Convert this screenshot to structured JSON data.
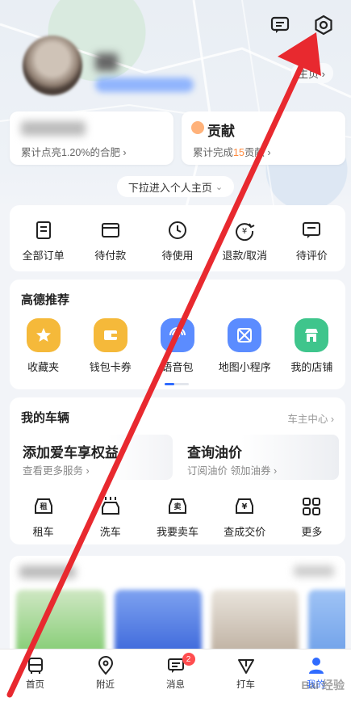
{
  "header": {
    "home_link": "主页 ›",
    "icons": [
      "message-icon",
      "settings-icon"
    ]
  },
  "stats": [
    {
      "title": "",
      "sub_pre": "累计点亮1.20%的合肥",
      "sub_hl": "",
      "sub_post": " ›"
    },
    {
      "title": "贡献",
      "sub_pre": "累计完成",
      "sub_hl": "15",
      "sub_post": "贡献 ›"
    }
  ],
  "pull_tip": "下拉进入个人主页",
  "orders": [
    {
      "label": "全部订单",
      "icon": "list-icon"
    },
    {
      "label": "待付款",
      "icon": "wallet-icon"
    },
    {
      "label": "待使用",
      "icon": "clock-icon"
    },
    {
      "label": "退款/取消",
      "icon": "refund-icon"
    },
    {
      "label": "待评价",
      "icon": "review-icon"
    }
  ],
  "recommend": {
    "title": "高德推荐",
    "items": [
      {
        "label": "收藏夹",
        "icon": "star-icon",
        "color": "#f5b93a"
      },
      {
        "label": "钱包卡券",
        "icon": "wallet-icon",
        "color": "#f5b93a"
      },
      {
        "label": "语音包",
        "icon": "voice-icon",
        "color": "#5b8cff"
      },
      {
        "label": "地图小程序",
        "icon": "mini-app-icon",
        "color": "#5b8cff"
      },
      {
        "label": "我的店铺",
        "icon": "shop-icon",
        "color": "#3fc58c"
      }
    ]
  },
  "vehicle": {
    "title": "我的车辆",
    "link": "车主中心 ›",
    "box1_title": "添加爱车享权益",
    "box1_sub": "查看更多服务 ›",
    "box2_title": "查询油价",
    "box2_sub": "订阅油价 领加油券 ›",
    "services": [
      {
        "label": "租车",
        "icon": "rent-car-icon",
        "glyph": "租"
      },
      {
        "label": "洗车",
        "icon": "car-wash-icon",
        "glyph": ""
      },
      {
        "label": "我要卖车",
        "icon": "sell-car-icon",
        "glyph": "卖"
      },
      {
        "label": "查成交价",
        "icon": "price-car-icon",
        "glyph": "¥"
      },
      {
        "label": "更多",
        "icon": "more-grid-icon",
        "glyph": ""
      }
    ]
  },
  "tabs": [
    {
      "label": "首页",
      "icon": "bus-icon"
    },
    {
      "label": "附近",
      "icon": "location-icon"
    },
    {
      "label": "消息",
      "icon": "message-icon",
      "badge": "2"
    },
    {
      "label": "打车",
      "icon": "taxi-icon"
    },
    {
      "label": "我的",
      "icon": "profile-icon"
    }
  ],
  "watermark": "Bai 经验",
  "colors": {
    "accent": "#2f6bff",
    "arrow": "#e8292f",
    "badge": "#ff4d4f"
  }
}
